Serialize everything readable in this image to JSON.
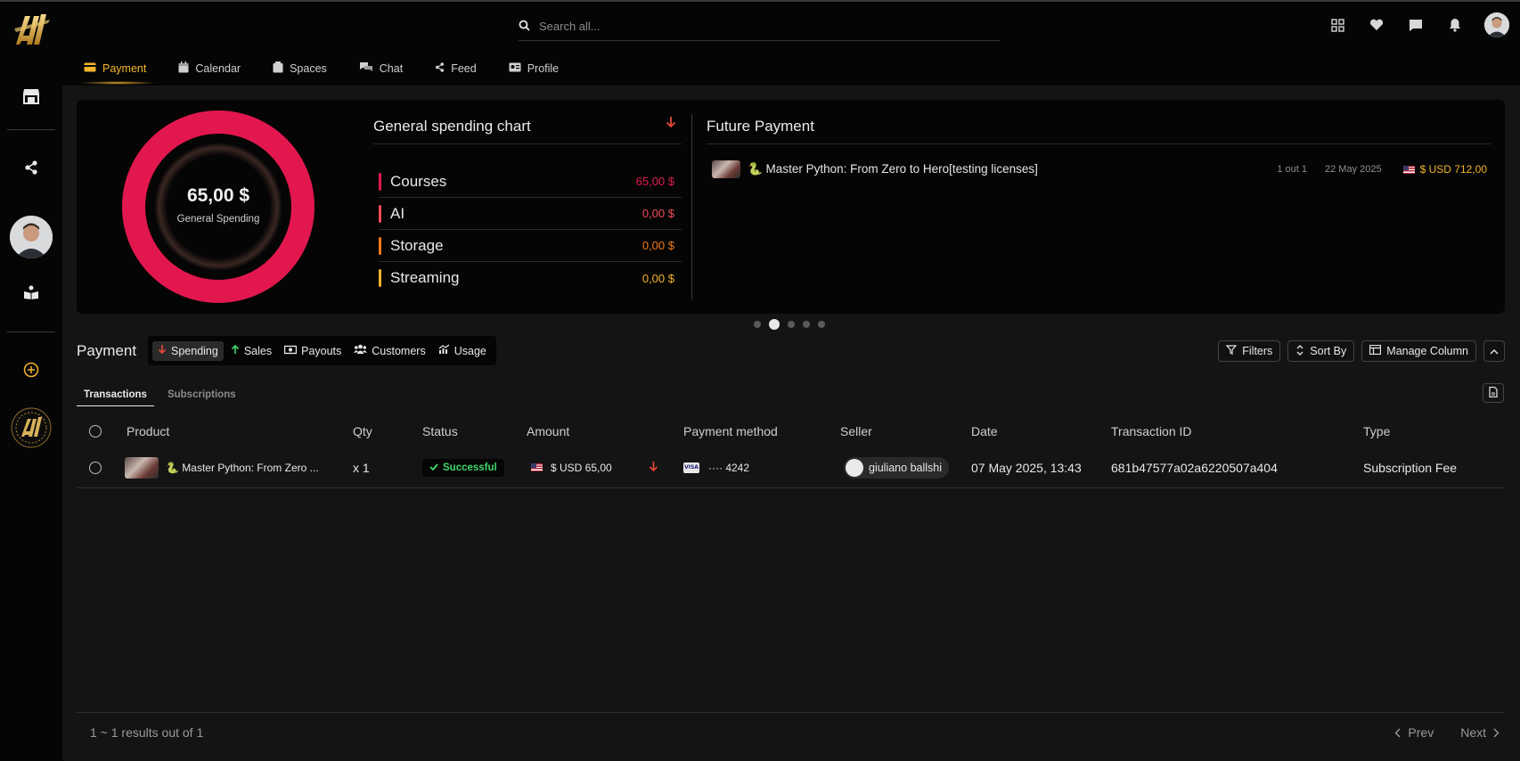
{
  "app": {
    "logo_text": "AI",
    "sidebar": {
      "icons": [
        "store-icon",
        "share-icon",
        "user-avatar",
        "book-icon",
        "plus-circle-icon",
        "badge-logo"
      ]
    }
  },
  "header": {
    "search": {
      "placeholder": "Search all..."
    },
    "icons": [
      "grid-icon",
      "heart-icon",
      "chat-icon",
      "bell-icon",
      "avatar"
    ]
  },
  "tabs": [
    {
      "label": "Payment",
      "icon": "card-icon",
      "active": true
    },
    {
      "label": "Calendar",
      "icon": "calendar-icon"
    },
    {
      "label": "Spaces",
      "icon": "spaces-icon"
    },
    {
      "label": "Chat",
      "icon": "chat-icon"
    },
    {
      "label": "Feed",
      "icon": "share-icon"
    },
    {
      "label": "Profile",
      "icon": "id-card-icon"
    }
  ],
  "spending": {
    "donut_value": "65,00 $",
    "donut_label": "General Spending",
    "title": "General spending chart",
    "rows": [
      {
        "name": "Courses",
        "value": "65,00 $",
        "color": "#e2174e"
      },
      {
        "name": "AI",
        "value": "0,00 $",
        "color": "#f04a56"
      },
      {
        "name": "Storage",
        "value": "0,00 $",
        "color": "#f07a1a"
      },
      {
        "name": "Streaming",
        "value": "0,00 $",
        "color": "#f3b42c"
      }
    ]
  },
  "future_payment": {
    "title": "Future Payment",
    "item": {
      "name": "🐍 Master Python: From Zero to Hero[testing licenses]",
      "count": "1 out 1",
      "date": "22 May 2025",
      "amount": "$ USD 712,00"
    }
  },
  "carousel": {
    "total": 5,
    "active": 2
  },
  "payment": {
    "title": "Payment",
    "tabs": [
      {
        "label": "Spending",
        "icon": "arrow-down-icon",
        "active": true
      },
      {
        "label": "Sales",
        "icon": "arrow-up-icon"
      },
      {
        "label": "Payouts",
        "icon": "cash-icon"
      },
      {
        "label": "Customers",
        "icon": "users-icon"
      },
      {
        "label": "Usage",
        "icon": "chart-icon"
      }
    ],
    "buttons": {
      "filters": "Filters",
      "sort": "Sort By",
      "manage": "Manage Column"
    },
    "sub_tabs": [
      {
        "label": "Transactions",
        "active": true
      },
      {
        "label": "Subscriptions"
      }
    ]
  },
  "table": {
    "columns": [
      "Product",
      "Qty",
      "Status",
      "Amount",
      "Payment method",
      "Seller",
      "Date",
      "Transaction ID",
      "Type"
    ],
    "rows": [
      {
        "product": "🐍 Master Python: From Zero ...",
        "qty": "x 1",
        "status": "Successful",
        "amount": "$ USD 65,00",
        "card": "···· 4242",
        "card_brand": "VISA",
        "seller": "giuliano ballshi",
        "date": "07 May 2025, 13:43",
        "transaction_id": "681b47577a02a6220507a404",
        "type": "Subscription Fee"
      }
    ]
  },
  "footer": {
    "results": "1 ~ 1 results out of 1",
    "prev": "Prev",
    "next": "Next"
  },
  "colors": {
    "accent": "#f3b42c",
    "donut": "#e2174e",
    "success": "#3fd86b",
    "down_arrow": "#e84a3a"
  }
}
